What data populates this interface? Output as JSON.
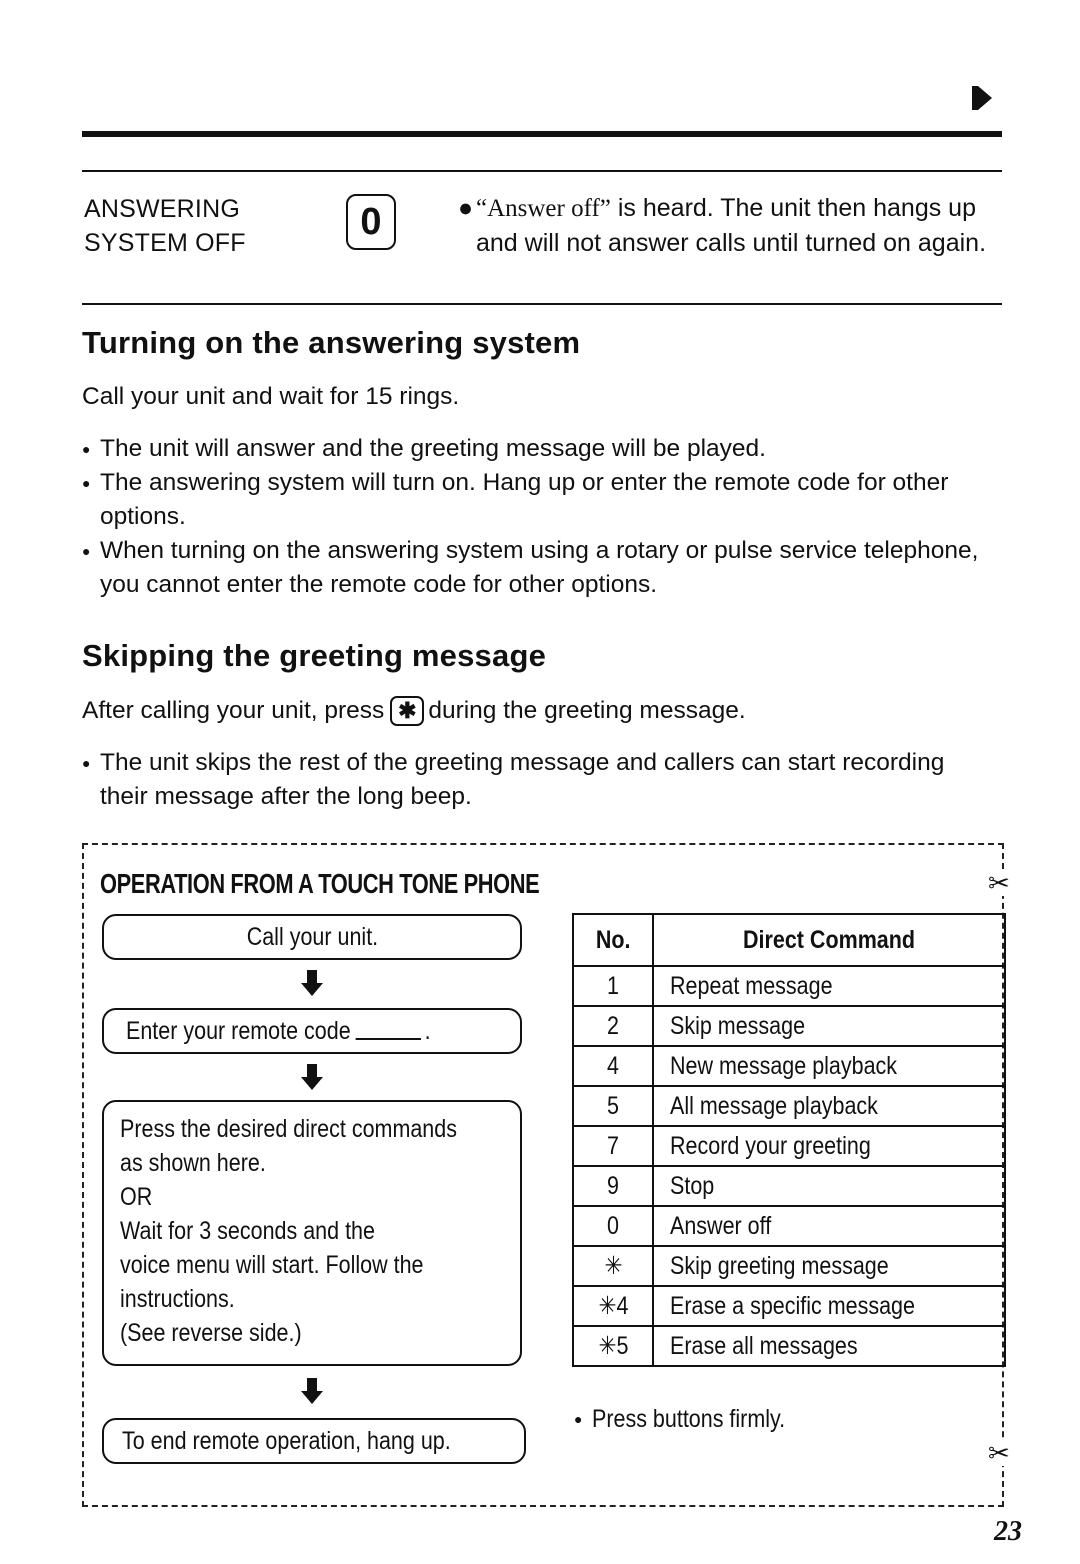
{
  "header": {
    "continue_arrow_icon": "right-arrow-icon"
  },
  "answering_off": {
    "label_line1": "ANSWERING",
    "label_line2": "SYSTEM OFF",
    "key": "0",
    "bullet": "●",
    "quote": "“Answer off”",
    "desc_rest": " is heard. The unit then hangs up and will not answer calls until turned on again."
  },
  "turning_on": {
    "heading": "Turning on the answering system",
    "intro": "Call your unit and wait for 15 rings.",
    "bullets": [
      "The unit will answer and the greeting message will be played.",
      "The answering system will turn on. Hang up or enter the remote code for other options.",
      "When turning on the answering system using a rotary or pulse service telephone, you cannot enter the remote code for other options."
    ]
  },
  "skipping": {
    "heading": "Skipping the greeting message",
    "intro_before": "After calling your unit, press",
    "key": "✱",
    "intro_after": "during the greeting message.",
    "bullets": [
      "The unit skips the rest of the greeting message and callers can start recording their message after the long beep."
    ]
  },
  "cut_card": {
    "title": "OPERATION FROM A TOUCH TONE PHONE",
    "scissors_icon": "✂",
    "flow": {
      "step1": "Call your unit.",
      "step2": "Enter your remote code",
      "step2_suffix": ".",
      "step3_lines": [
        "Press the desired direct commands",
        "as shown here.",
        "OR",
        "Wait for 3 seconds and the",
        "voice menu will start. Follow the",
        "instructions.",
        "(See reverse side.)"
      ],
      "step4": "To end remote operation, hang up."
    },
    "table": {
      "headers": [
        "No.",
        "Direct Command"
      ],
      "rows": [
        {
          "no": "1",
          "command": "Repeat message"
        },
        {
          "no": "2",
          "command": "Skip message"
        },
        {
          "no": "4",
          "command": "New message playback"
        },
        {
          "no": "5",
          "command": "All message playback"
        },
        {
          "no": "7",
          "command": "Record your greeting"
        },
        {
          "no": "9",
          "command": "Stop"
        },
        {
          "no": "0",
          "command": "Answer off"
        },
        {
          "no": "✳",
          "command": "Skip greeting message"
        },
        {
          "no": "✳4",
          "command": "Erase a specific message"
        },
        {
          "no": "✳5",
          "command": "Erase all messages"
        }
      ]
    },
    "note": "Press buttons firmly."
  },
  "footer": {
    "page_number": "23"
  }
}
